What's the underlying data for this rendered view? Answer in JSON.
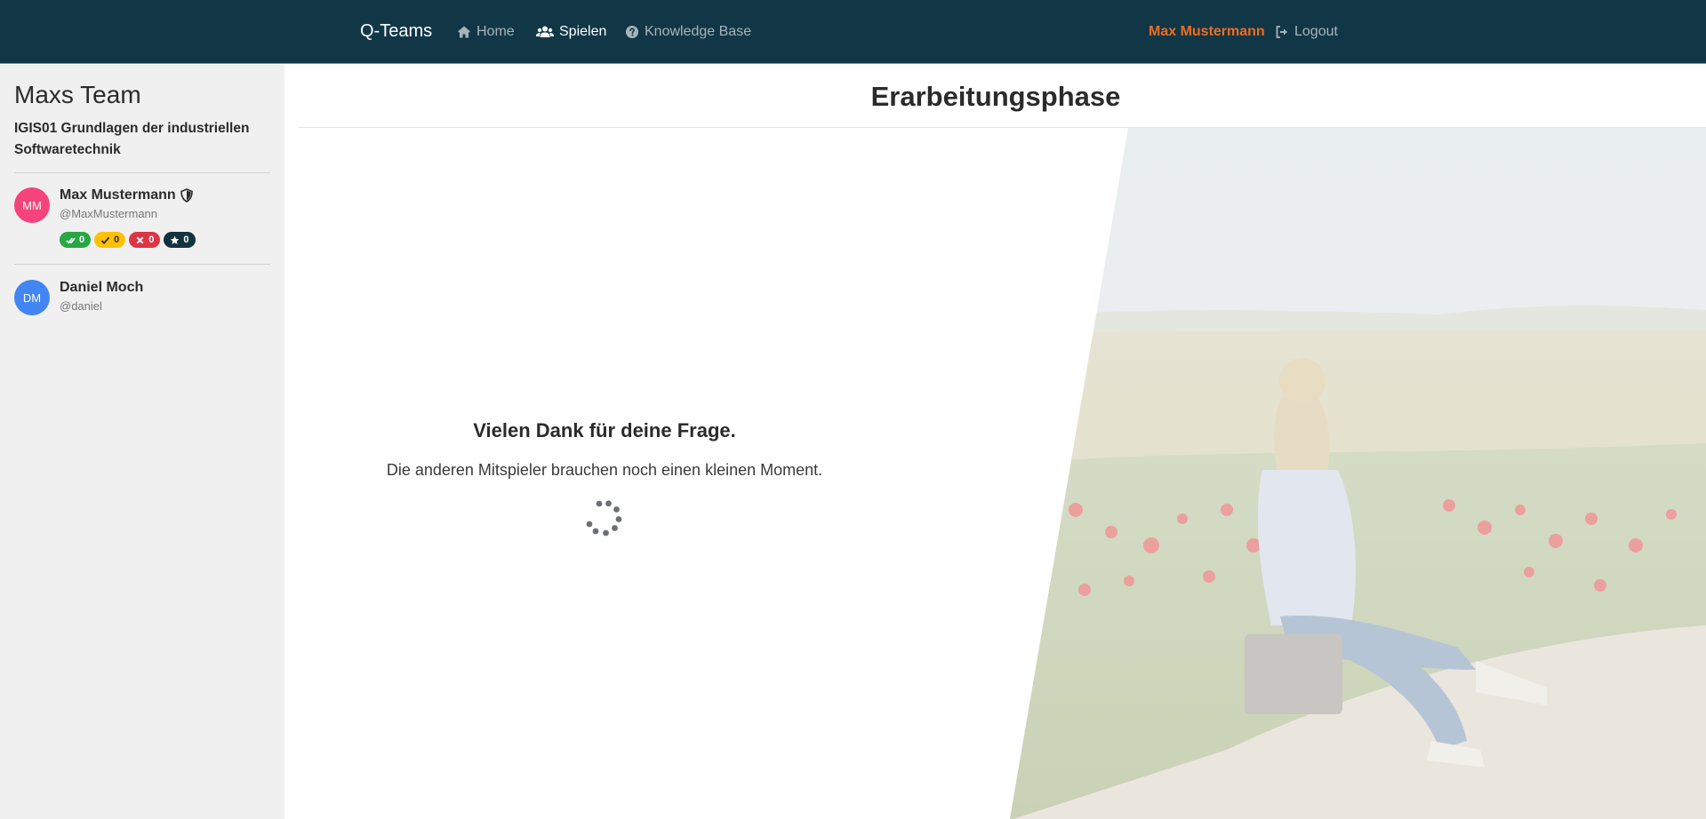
{
  "nav": {
    "brand": "Q-Teams",
    "home": "Home",
    "spielen": "Spielen",
    "knowledge_base": "Knowledge Base",
    "user": "Max Mustermann",
    "logout": "Logout",
    "accent_color": "#f26b1d",
    "background_color": "#113747"
  },
  "sidebar": {
    "team_name": "Maxs Team",
    "course": "IGIS01 Grundlagen der industriellen Softwaretechnik",
    "members": [
      {
        "initials": "MM",
        "name": "Max Mustermann",
        "handle": "@MaxMustermann",
        "avatar_color": "#f5437c",
        "role_icon": "shield-icon",
        "badges": [
          {
            "icon": "double-check-icon",
            "value": "0",
            "color": "#28a745"
          },
          {
            "icon": "check-icon",
            "value": "0",
            "color": "#ffc107"
          },
          {
            "icon": "x-icon",
            "value": "0",
            "color": "#dc3545"
          },
          {
            "icon": "star-icon",
            "value": "0",
            "color": "#13323f"
          }
        ]
      },
      {
        "initials": "DM",
        "name": "Daniel Moch",
        "handle": "@daniel",
        "avatar_color": "#4285f4"
      }
    ]
  },
  "main": {
    "phase_title": "Erarbeitungsphase",
    "thanks": "Vielen Dank für deine Frage.",
    "waiting": "Die anderen Mitspieler brauchen noch einen kleinen Moment."
  }
}
